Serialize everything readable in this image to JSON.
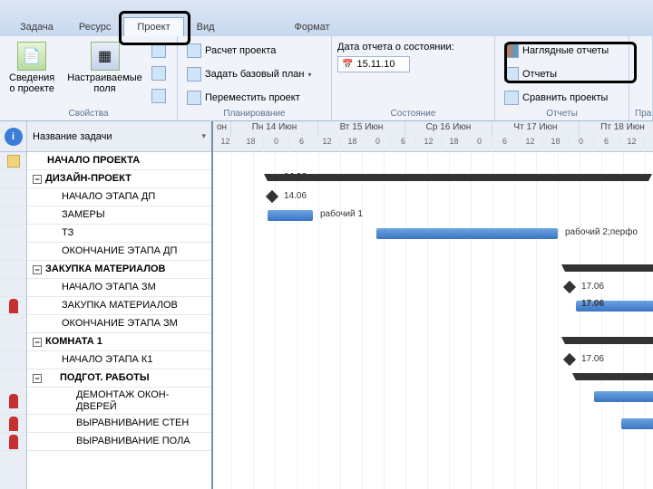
{
  "ribbon": {
    "tabs": [
      "Задача",
      "Ресурс",
      "Проект",
      "Вид",
      "Формат"
    ],
    "active_tab": "Проект",
    "groups": {
      "props": {
        "label": "Свойства",
        "info_btn": "Сведения\nо проекте",
        "fields_btn": "Настраиваемые\nполя"
      },
      "planning": {
        "label": "Планирование",
        "calc": "Расчет проекта",
        "baseline": "Задать базовый план",
        "move": "Переместить проект"
      },
      "status": {
        "label": "Состояние",
        "date_label": "Дата отчета о состоянии:",
        "date_value": "15.11.10"
      },
      "reports": {
        "label": "Отчеты",
        "visual": "Наглядные отчеты",
        "reports": "Отчеты",
        "compare": "Сравнить проекты"
      },
      "tail": "Пра"
    }
  },
  "task_header": "Название задачи",
  "tasks": [
    {
      "name": "НАЧАЛО ПРОЕКТА",
      "bold": true,
      "indent": 1,
      "icon": "flag"
    },
    {
      "name": "ДИЗАЙН-ПРОЕКТ",
      "bold": true,
      "indent": 0,
      "collapse": true
    },
    {
      "name": "НАЧАЛО ЭТАПА ДП",
      "indent": 2
    },
    {
      "name": "ЗАМЕРЫ",
      "indent": 2
    },
    {
      "name": "ТЗ",
      "indent": 2
    },
    {
      "name": "ОКОНЧАНИЕ ЭТАПА ДП",
      "indent": 2
    },
    {
      "name": "ЗАКУПКА МАТЕРИАЛОВ",
      "bold": true,
      "indent": 0,
      "collapse": true
    },
    {
      "name": "НАЧАЛО ЭТАПА ЗМ",
      "indent": 2
    },
    {
      "name": "ЗАКУПКА МАТЕРИАЛОВ",
      "indent": 2,
      "icon": "man"
    },
    {
      "name": "ОКОНЧАНИЕ ЭТАПА ЗМ",
      "indent": 2
    },
    {
      "name": "КОМНАТА 1",
      "bold": true,
      "indent": 0,
      "collapse": true
    },
    {
      "name": "НАЧАЛО ЭТАПА К1",
      "indent": 2
    },
    {
      "name": "ПОДГОТ. РАБОТЫ",
      "bold": true,
      "indent": 1,
      "collapse": true
    },
    {
      "name": "ДЕМОНТАЖ ОКОН-ДВЕРЕЙ",
      "indent": 3,
      "icon": "man",
      "multiline": true
    },
    {
      "name": "ВЫРАВНИВАНИЕ СТЕН",
      "indent": 3,
      "icon": "man"
    },
    {
      "name": "ВЫРАВНИВАНИЕ ПОЛА",
      "indent": 3,
      "icon": "man"
    }
  ],
  "timeline": {
    "unit_label": "он",
    "days": [
      "Пн 14 Июн",
      "Вт 15 Июн",
      "Ср 16 Июн",
      "Чт 17 Июн",
      "Пт 18 Июн"
    ],
    "hours": [
      "12",
      "18",
      "0",
      "6",
      "12",
      "18",
      "0",
      "6",
      "12",
      "18",
      "0",
      "6",
      "12",
      "18",
      "0",
      "6",
      "12",
      "18"
    ]
  },
  "gantt_labels": {
    "m1": "14.06",
    "m2": "14.06",
    "w1": "рабочий 1",
    "w2": "рабочий 2;перфо",
    "d1": "17.06",
    "d2": "17.06",
    "d3": "17.06"
  },
  "chart_data": {
    "type": "gantt",
    "title": "",
    "time_axis": {
      "unit": "day/hour",
      "days": [
        "14 Июн",
        "15 Июн",
        "16 Июн",
        "17 Июн",
        "18 Июн"
      ],
      "hour_ticks": [
        0,
        6,
        12,
        18
      ]
    },
    "items": [
      {
        "task": "ДИЗАЙН-ПРОЕКТ",
        "type": "summary",
        "start": "14.06 08:00",
        "end": "18.06 18:00"
      },
      {
        "task": "НАЧАЛО ЭТАПА ДП",
        "type": "milestone",
        "date": "14.06"
      },
      {
        "task": "ЗАМЕРЫ",
        "type": "bar",
        "start": "14.06 08:00",
        "end": "14.06 18:00",
        "resource": "рабочий 1"
      },
      {
        "task": "ТЗ",
        "type": "bar",
        "start": "15.06 08:00",
        "end": "17.06 12:00",
        "resource": "рабочий 2;перфо"
      },
      {
        "task": "ЗАКУПКА МАТЕРИАЛОВ (summary)",
        "type": "summary",
        "start": "17.06 08:00",
        "end": "18.06 18:00"
      },
      {
        "task": "НАЧАЛО ЭТАПА ЗМ",
        "type": "milestone",
        "date": "17.06"
      },
      {
        "task": "ЗАКУПКА МАТЕРИАЛОВ",
        "type": "bar",
        "start": "17.06 08:00",
        "end": "18.06 18:00"
      },
      {
        "task": "КОМНАТА 1",
        "type": "summary",
        "start": "17.06 08:00",
        "end": "18.06 18:00"
      },
      {
        "task": "НАЧАЛО ЭТАПА К1",
        "type": "milestone",
        "date": "17.06"
      },
      {
        "task": "ПОДГОТ. РАБОТЫ",
        "type": "summary",
        "start": "17.06 08:00",
        "end": "18.06 18:00"
      },
      {
        "task": "ДЕМОНТАЖ ОКОН-ДВЕРЕЙ",
        "type": "bar",
        "start": "17.06 12:00",
        "end": "18.06 18:00"
      },
      {
        "task": "ВЫРАВНИВАНИЕ СТЕН",
        "type": "bar",
        "start": "18.06 00:00",
        "end": "18.06 18:00"
      }
    ]
  }
}
